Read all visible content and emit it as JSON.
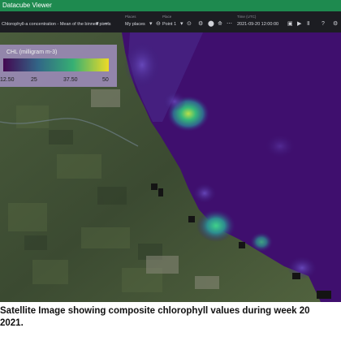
{
  "app": {
    "title": "Datacube Viewer"
  },
  "toolbar": {
    "layer_label": "Chlorophyll-a concentration - Mean of the binned pixels",
    "places_label": "Places",
    "places_value": "My places",
    "place_label": "Place",
    "place_value": "Point 1",
    "time_label": "Time (UTC)",
    "time_value": "2021-09-20 12:00:00",
    "icons": [
      "dropdown-caret-icon",
      "chart-icon",
      "remove-icon",
      "location-pin-icon",
      "layers-icon",
      "play-icon",
      "settings-icon",
      "more-icon"
    ]
  },
  "legend": {
    "title": "CHL (milligram m-3)",
    "ticks": [
      "12.50",
      "25",
      "37.50",
      "50"
    ],
    "colors": [
      "#440154",
      "#31688e",
      "#35b779",
      "#fde725"
    ]
  },
  "caption": {
    "line1": "Satellite Image showing composite chlorophyll values during week 20",
    "line2": "2021."
  },
  "colors": {
    "app_bar": "#1e8a4f",
    "toolbar": "#1c1d22",
    "sea": "#3f0f6e",
    "land": "#3d4d34"
  }
}
